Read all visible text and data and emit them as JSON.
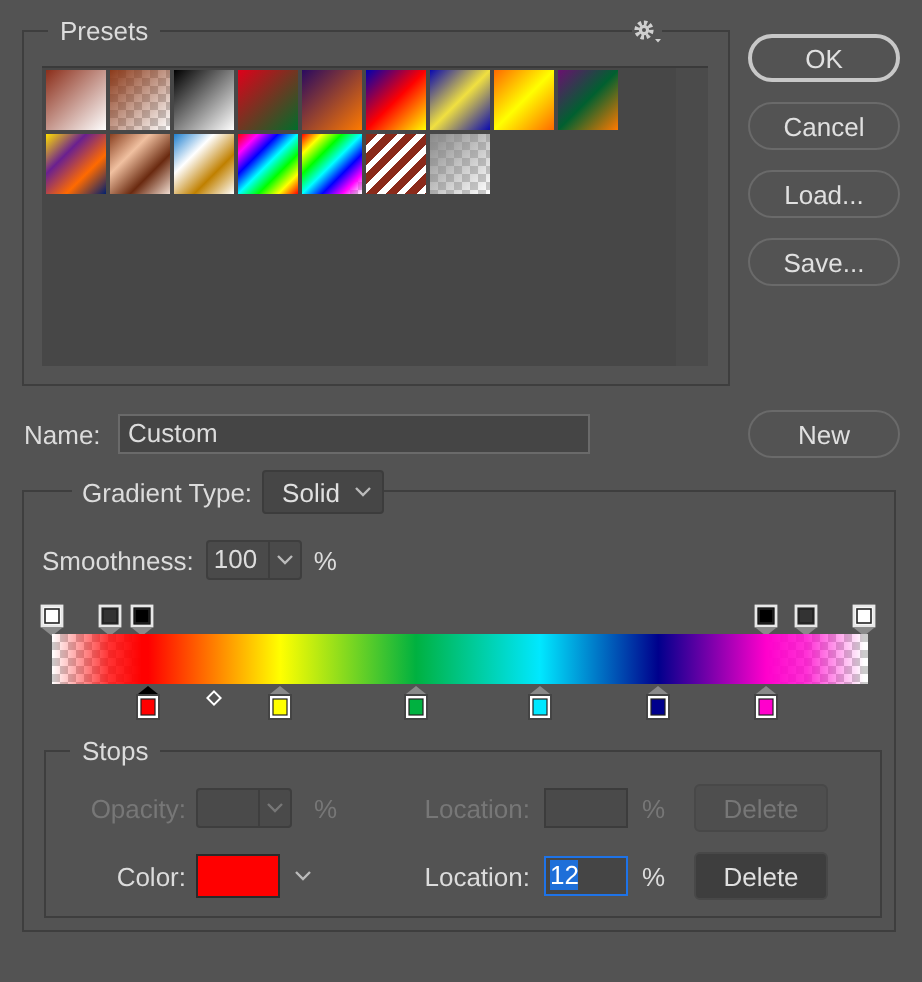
{
  "presets": {
    "title": "Presets"
  },
  "buttons": [
    {
      "label": "OK",
      "default": true
    },
    {
      "label": "Cancel",
      "default": false
    },
    {
      "label": "Load...",
      "default": false
    },
    {
      "label": "Save...",
      "default": false
    }
  ],
  "name": {
    "label": "Name:",
    "value": "Custom"
  },
  "new_button": "New",
  "gradient": {
    "type_label": "Gradient Type:",
    "type_value": "Solid",
    "smoothness_label": "Smoothness:",
    "smoothness_value": "100",
    "smoothness_unit": "%",
    "opacity_stops": [
      {
        "level": 0,
        "color": "#ffffff"
      },
      {
        "level": 0.07,
        "color": "#333333"
      },
      {
        "level": 0.11,
        "color": "#000000"
      },
      {
        "level": 0.875,
        "color": "#000000"
      },
      {
        "level": 0.925,
        "color": "#333333"
      },
      {
        "level": 0.995,
        "color": "#ffffff"
      }
    ],
    "color_stops": [
      {
        "level": 0.118,
        "color": "#ff0000",
        "selected": true
      },
      {
        "level": 0.28,
        "color": "#ffff00",
        "selected": false
      },
      {
        "level": 0.446,
        "color": "#00b140",
        "selected": false
      },
      {
        "level": 0.598,
        "color": "#00e8ff",
        "selected": false
      },
      {
        "level": 0.743,
        "color": "#00008c",
        "selected": false
      },
      {
        "level": 0.875,
        "color": "#ff00cc",
        "selected": false
      }
    ]
  },
  "stops": {
    "title": "Stops",
    "rows": [
      {
        "kind": "opacity",
        "label": "Opacity:",
        "unit": "%",
        "location_label": "Location:",
        "location_unit": "%",
        "delete": "Delete",
        "disabled": true
      },
      {
        "kind": "color",
        "label": "Color:",
        "color": "#ff0000",
        "location_label": "Location:",
        "location_value": "12",
        "location_unit": "%",
        "delete": "Delete",
        "disabled": false
      }
    ]
  }
}
